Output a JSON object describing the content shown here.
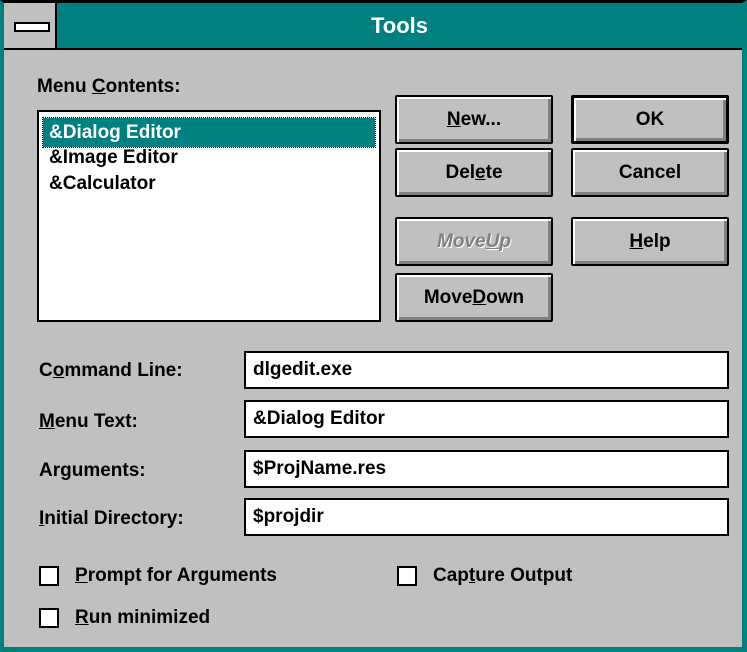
{
  "window": {
    "title": "Tools"
  },
  "menu_contents": {
    "label_pre": "Menu ",
    "label_ul": "C",
    "label_post": "ontents:",
    "items": [
      {
        "label": "&Dialog Editor",
        "selected": true
      },
      {
        "label": "&Image Editor",
        "selected": false
      },
      {
        "label": "&Calculator",
        "selected": false
      }
    ]
  },
  "buttons": {
    "new": {
      "pre": "",
      "ul": "N",
      "post": "ew..."
    },
    "ok": {
      "label": "OK"
    },
    "delete": {
      "pre": "Del",
      "ul": "e",
      "post": "te"
    },
    "cancel": {
      "label": "Cancel"
    },
    "move_up": {
      "pre": "Move ",
      "ul": "U",
      "post": "p"
    },
    "help": {
      "pre": "",
      "ul": "H",
      "post": "elp"
    },
    "move_down": {
      "pre": "Move ",
      "ul": "D",
      "post": "own"
    }
  },
  "fields": {
    "command_line": {
      "pre": "C",
      "ul": "o",
      "post": "mmand Line:",
      "value": "dlgedit.exe"
    },
    "menu_text": {
      "pre": "",
      "ul": "M",
      "post": "enu Text:",
      "value": "&Dialog Editor"
    },
    "arguments": {
      "pre": "",
      "ul": "",
      "post": "Arguments:",
      "value": "$ProjName.res"
    },
    "initial_directory": {
      "pre": "",
      "ul": "I",
      "post": "nitial Directory:",
      "value": "$projdir"
    }
  },
  "checkboxes": {
    "prompt": {
      "pre": "",
      "ul": "P",
      "post": "rompt for Arguments",
      "checked": false
    },
    "capture": {
      "pre": "Cap",
      "ul": "t",
      "post": "ure Output",
      "checked": false
    },
    "minimized": {
      "pre": "",
      "ul": "R",
      "post": "un minimized",
      "checked": false
    }
  }
}
